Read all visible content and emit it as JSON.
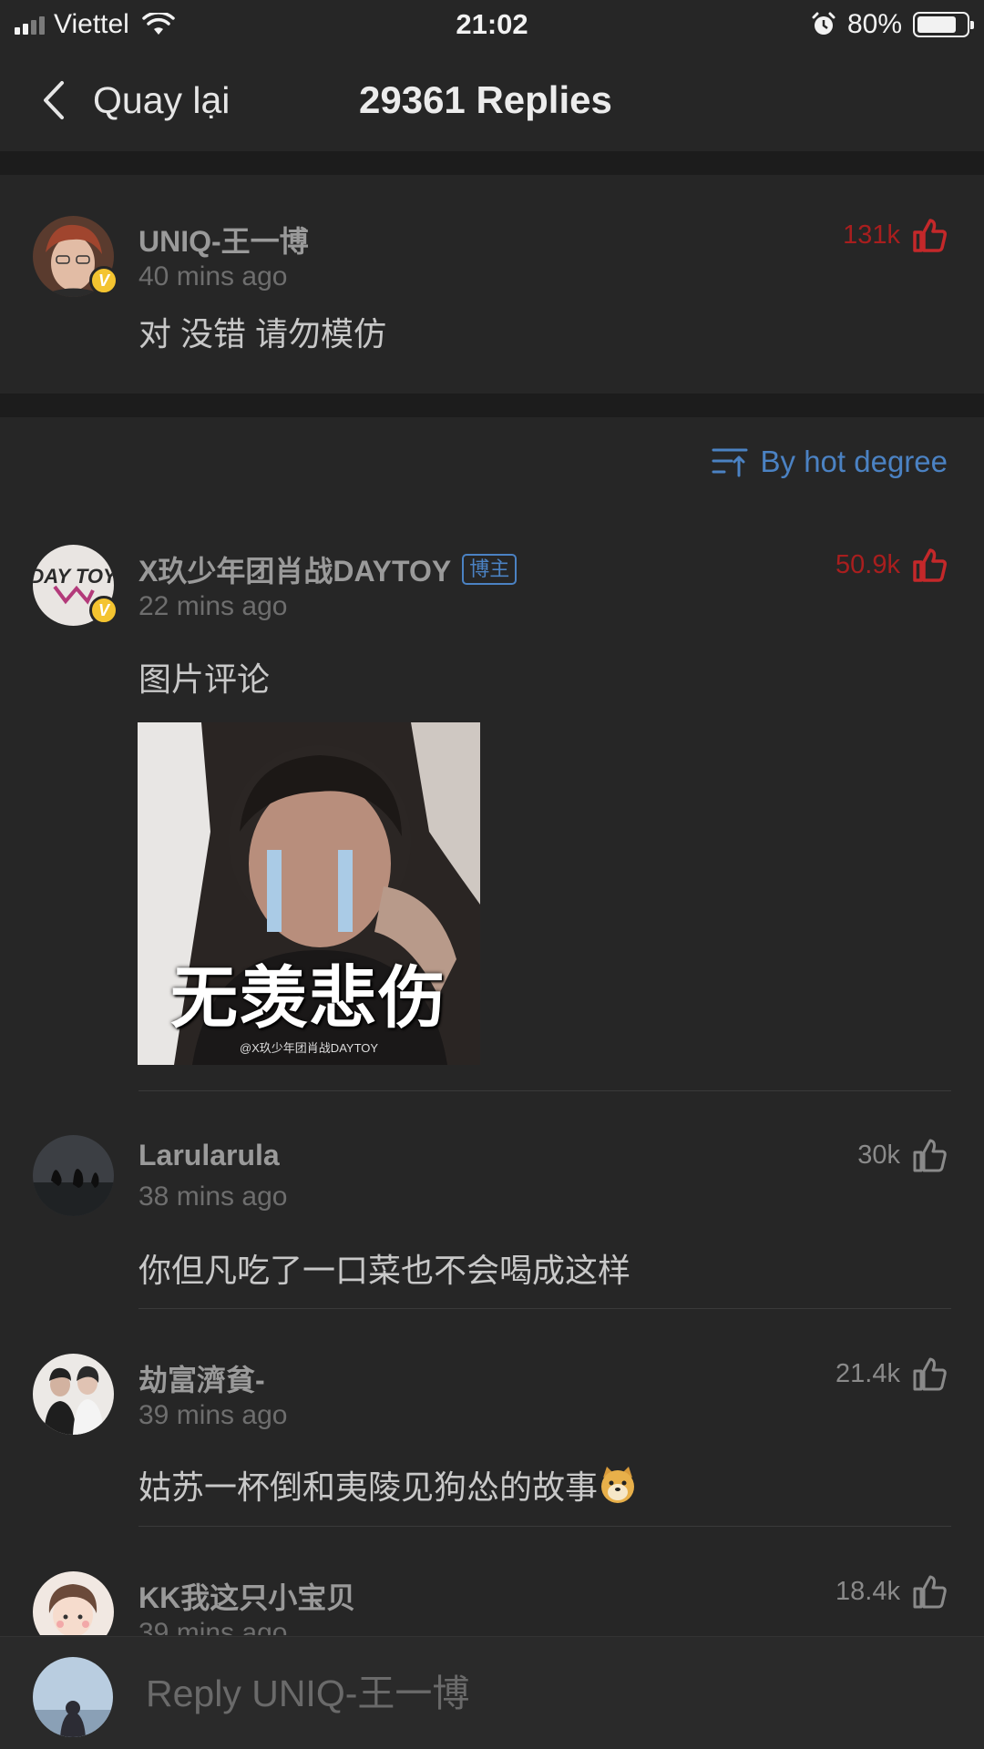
{
  "status_bar": {
    "carrier": "Viettel",
    "time": "21:02",
    "battery_percent": "80%",
    "battery_level": 0.8
  },
  "nav": {
    "back_label": "Quay lại",
    "title": "29361 Replies"
  },
  "root_comment": {
    "username": "UNIQ-王一博",
    "time": "40 mins ago",
    "text": "对 没错 请勿模仿",
    "likes": "131k",
    "verified": "V"
  },
  "sort": {
    "label": "By hot degree"
  },
  "replies": [
    {
      "username": "X玖少年团肖战DAYTOY",
      "badge": "博主",
      "time": "22 mins ago",
      "text": "图片评论",
      "likes": "50.9k",
      "verified": "V",
      "avatar_text": "DAY TOY",
      "image_caption": "无羡悲伤",
      "image_watermark": "@X玖少年团肖战DAYTOY"
    },
    {
      "username": "Larularula",
      "time": "38 mins ago",
      "text": "你但凡吃了一口菜也不会喝成这样",
      "likes": "30k"
    },
    {
      "username": "劫富濟貧-",
      "time": "39 mins ago",
      "text": "姑苏一杯倒和夷陵见狗怂的故事",
      "likes": "21.4k"
    },
    {
      "username": "KK我这只小宝贝",
      "time": "39 mins ago",
      "likes": "18.4k"
    }
  ],
  "reply_bar": {
    "placeholder": "Reply UNIQ-王一博"
  },
  "colors": {
    "background": "#262626",
    "accent_blue": "#4b82c3",
    "hot_red": "#a81e1e",
    "verified_yellow": "#f4c430"
  },
  "icons": [
    "signal-icon",
    "wifi-icon",
    "alarm-icon",
    "battery-icon",
    "back-chevron-icon",
    "thumbs-up-icon",
    "sort-icon",
    "verified-icon",
    "doge-emoji-icon"
  ]
}
